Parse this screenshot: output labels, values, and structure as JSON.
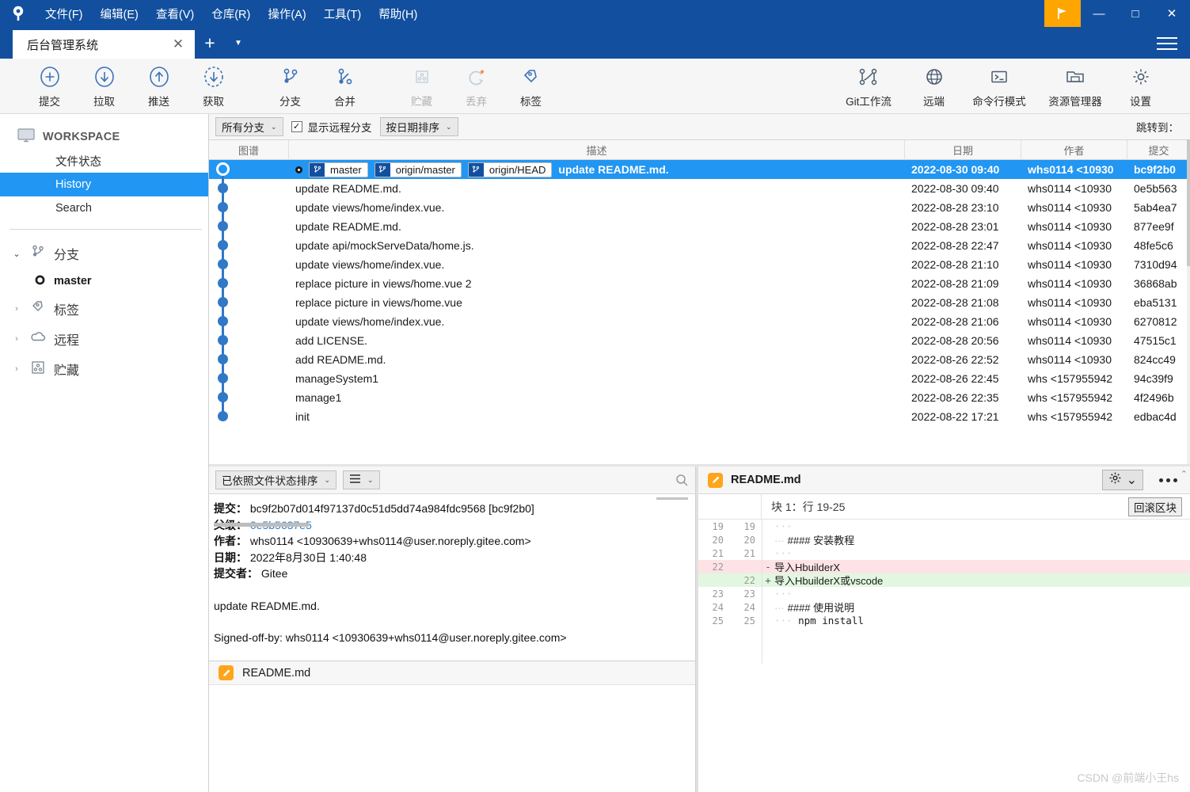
{
  "app": {
    "logo_icon": "sourcetree-logo-icon",
    "menus": [
      {
        "label": "文件(F)",
        "accel": "F"
      },
      {
        "label": "编辑(E)",
        "accel": "E"
      },
      {
        "label": "查看(V)",
        "accel": "V"
      },
      {
        "label": "仓库(R)",
        "accel": "R"
      },
      {
        "label": "操作(A)",
        "accel": "A"
      },
      {
        "label": "工具(T)",
        "accel": "T"
      },
      {
        "label": "帮助(H)",
        "accel": "H"
      }
    ],
    "window_controls": {
      "flag_icon": "flag-icon",
      "minimize": "—",
      "maximize": "□",
      "close": "✕",
      "menu_icon": "hamburger-icon"
    }
  },
  "tabs": {
    "items": [
      {
        "label": "后台管理系统",
        "active": true
      }
    ],
    "close_label": "✕",
    "add_label": "+",
    "caret_label": "▼"
  },
  "toolbar": {
    "left": [
      {
        "label": "提交",
        "icon": "plus-circle-icon",
        "disabled": false
      },
      {
        "label": "拉取",
        "icon": "arrow-down-circle-icon",
        "disabled": false
      },
      {
        "label": "推送",
        "icon": "arrow-up-circle-icon",
        "disabled": false
      },
      {
        "label": "获取",
        "icon": "fetch-dashed-circle-icon",
        "disabled": false
      },
      {
        "label": "分支",
        "icon": "branch-icon",
        "disabled": false
      },
      {
        "label": "合并",
        "icon": "merge-icon",
        "disabled": false
      },
      {
        "label": "贮藏",
        "icon": "stash-icon",
        "disabled": true
      },
      {
        "label": "丢弃",
        "icon": "discard-refresh-icon",
        "disabled": true
      },
      {
        "label": "标签",
        "icon": "tag-icon",
        "disabled": false
      }
    ],
    "right": [
      {
        "label": "Git工作流",
        "icon": "gitflow-icon"
      },
      {
        "label": "远端",
        "icon": "globe-icon"
      },
      {
        "label": "命令行模式",
        "icon": "terminal-icon"
      },
      {
        "label": "资源管理器",
        "icon": "folder-explorer-icon"
      },
      {
        "label": "设置",
        "icon": "gear-icon"
      }
    ]
  },
  "sidebar": {
    "workspace": {
      "label": "WORKSPACE",
      "icon": "monitor-icon"
    },
    "items": [
      {
        "label": "文件状态",
        "selected": false
      },
      {
        "label": "History",
        "selected": true
      },
      {
        "label": "Search",
        "selected": false
      }
    ],
    "groups": [
      {
        "label": "分支",
        "icon": "branch-icon",
        "expanded": true,
        "chevron": "⌄",
        "children": [
          {
            "label": "master",
            "icon": "commit-dot-icon"
          }
        ]
      },
      {
        "label": "标签",
        "icon": "tag-icon",
        "expanded": false,
        "chevron": "›",
        "children": []
      },
      {
        "label": "远程",
        "icon": "cloud-icon",
        "expanded": false,
        "chevron": "›",
        "children": []
      },
      {
        "label": "贮藏",
        "icon": "stash-icon",
        "expanded": false,
        "chevron": "›",
        "children": []
      }
    ]
  },
  "filterbar": {
    "branch_filter": {
      "value": "所有分支",
      "caret": "⌄"
    },
    "show_remote": {
      "label": "显示远程分支",
      "checked": true,
      "mark": "✓"
    },
    "sort": {
      "value": "按日期排序",
      "caret": "⌄"
    },
    "jump_to_label": "跳转到："
  },
  "commit_table": {
    "columns": [
      {
        "key": "graph",
        "label": "图谱"
      },
      {
        "key": "description",
        "label": "描述"
      },
      {
        "key": "date",
        "label": "日期"
      },
      {
        "key": "author",
        "label": "作者"
      },
      {
        "key": "commit",
        "label": "提交"
      }
    ],
    "rows": [
      {
        "refs": [
          "master",
          "origin/master",
          "origin/HEAD"
        ],
        "description": "update README.md.",
        "date": "2022-08-30 09:40",
        "author": "whs0114 <10930",
        "commit": "bc9f2b0",
        "selected": true
      },
      {
        "refs": [],
        "description": "update README.md.",
        "date": "2022-08-30 09:40",
        "author": "whs0114 <10930",
        "commit": "0e5b563",
        "selected": false
      },
      {
        "refs": [],
        "description": "update views/home/index.vue.",
        "date": "2022-08-28 23:10",
        "author": "whs0114 <10930",
        "commit": "5ab4ea7",
        "selected": false
      },
      {
        "refs": [],
        "description": "update README.md.",
        "date": "2022-08-28 23:01",
        "author": "whs0114 <10930",
        "commit": "877ee9f",
        "selected": false
      },
      {
        "refs": [],
        "description": "update api/mockServeData/home.js.",
        "date": "2022-08-28 22:47",
        "author": "whs0114 <10930",
        "commit": "48fe5c6",
        "selected": false
      },
      {
        "refs": [],
        "description": "update views/home/index.vue.",
        "date": "2022-08-28 21:10",
        "author": "whs0114 <10930",
        "commit": "7310d94",
        "selected": false
      },
      {
        "refs": [],
        "description": "replace picture in views/home.vue 2",
        "date": "2022-08-28 21:09",
        "author": "whs0114 <10930",
        "commit": "36868ab",
        "selected": false
      },
      {
        "refs": [],
        "description": "replace picture in views/home.vue",
        "date": "2022-08-28 21:08",
        "author": "whs0114 <10930",
        "commit": "eba5131",
        "selected": false
      },
      {
        "refs": [],
        "description": "update views/home/index.vue.",
        "date": "2022-08-28 21:06",
        "author": "whs0114 <10930",
        "commit": "6270812",
        "selected": false
      },
      {
        "refs": [],
        "description": "add LICENSE.",
        "date": "2022-08-28 20:56",
        "author": "whs0114 <10930",
        "commit": "47515c1",
        "selected": false
      },
      {
        "refs": [],
        "description": "add README.md.",
        "date": "2022-08-26 22:52",
        "author": "whs0114 <10930",
        "commit": "824cc49",
        "selected": false
      },
      {
        "refs": [],
        "description": "manageSystem1",
        "date": "2022-08-26 22:45",
        "author": "whs <157955942",
        "commit": "94c39f9",
        "selected": false
      },
      {
        "refs": [],
        "description": "manage1",
        "date": "2022-08-26 22:35",
        "author": "whs <157955942",
        "commit": "4f2496b",
        "selected": false
      },
      {
        "refs": [],
        "description": "init",
        "date": "2022-08-22 17:21",
        "author": "whs <157955942",
        "commit": "edbac4d",
        "selected": false
      }
    ]
  },
  "detail_panel": {
    "sort_select": {
      "value": "已依照文件状态排序",
      "caret": "⌄"
    },
    "view_select": {
      "icon": "list-lines-icon",
      "caret": "⌄"
    },
    "search_icon": "search-icon",
    "fields": [
      {
        "label": "提交：",
        "value": "bc9f2b07d014f97137d0c51d5dd74a984fdc9568 [bc9f2b0]",
        "link": false
      },
      {
        "label": "父级：",
        "value": "0e5b5637e5",
        "link": true
      },
      {
        "label": "作者：",
        "value": "whs0114 <10930639+whs0114@user.noreply.gitee.com>",
        "link": false
      },
      {
        "label": "日期：",
        "value": "2022年8月30日 1:40:48",
        "link": false
      },
      {
        "label": "提交者：",
        "value": "Gitee",
        "link": false
      }
    ],
    "message": "update README.md.",
    "signoff": "Signed-off-by: whs0114 <10930639+whs0114@user.noreply.gitee.com>",
    "files": [
      {
        "name": "README.md",
        "icon": "markdown-file-icon"
      }
    ]
  },
  "diff_panel": {
    "file_name": "README.md",
    "file_icon": "markdown-file-icon",
    "gear_icon": "gear-icon",
    "gear_caret": "⌄",
    "more_icon": "ellipsis-icon",
    "scroll_up_icon": "chevron-up-icon",
    "hunk_header": "块 1：行 19-25",
    "rollback_label": "回滚区块",
    "lines": [
      {
        "old": "19",
        "new": "19",
        "sign": "",
        "text": "",
        "type": "ctx"
      },
      {
        "old": "20",
        "new": "20",
        "sign": "",
        "text": "#### 安装教程",
        "type": "ctx"
      },
      {
        "old": "21",
        "new": "21",
        "sign": "",
        "text": "",
        "type": "ctx"
      },
      {
        "old": "22",
        "new": "",
        "sign": "-",
        "text": "导入HbuilderX",
        "type": "del"
      },
      {
        "old": "",
        "new": "22",
        "sign": "+",
        "text": "导入HbuilderX或vscode",
        "type": "add"
      },
      {
        "old": "23",
        "new": "23",
        "sign": "",
        "text": "",
        "type": "ctx"
      },
      {
        "old": "24",
        "new": "24",
        "sign": "",
        "text": "#### 使用说明",
        "type": "ctx"
      },
      {
        "old": "25",
        "new": "25",
        "sign": "",
        "text": "npm install",
        "type": "ctx"
      }
    ]
  },
  "watermark": "CSDN @前端小王hs",
  "colors": {
    "title_bar": "#12509f",
    "accent_blue": "#2196f3",
    "graph_blue": "#3178c6",
    "flag_orange": "#FFA500",
    "md_icon_orange": "#FFA41B",
    "diff_add": "#e2f7e0",
    "diff_del": "#fde3e6",
    "link": "#2f79c8"
  }
}
